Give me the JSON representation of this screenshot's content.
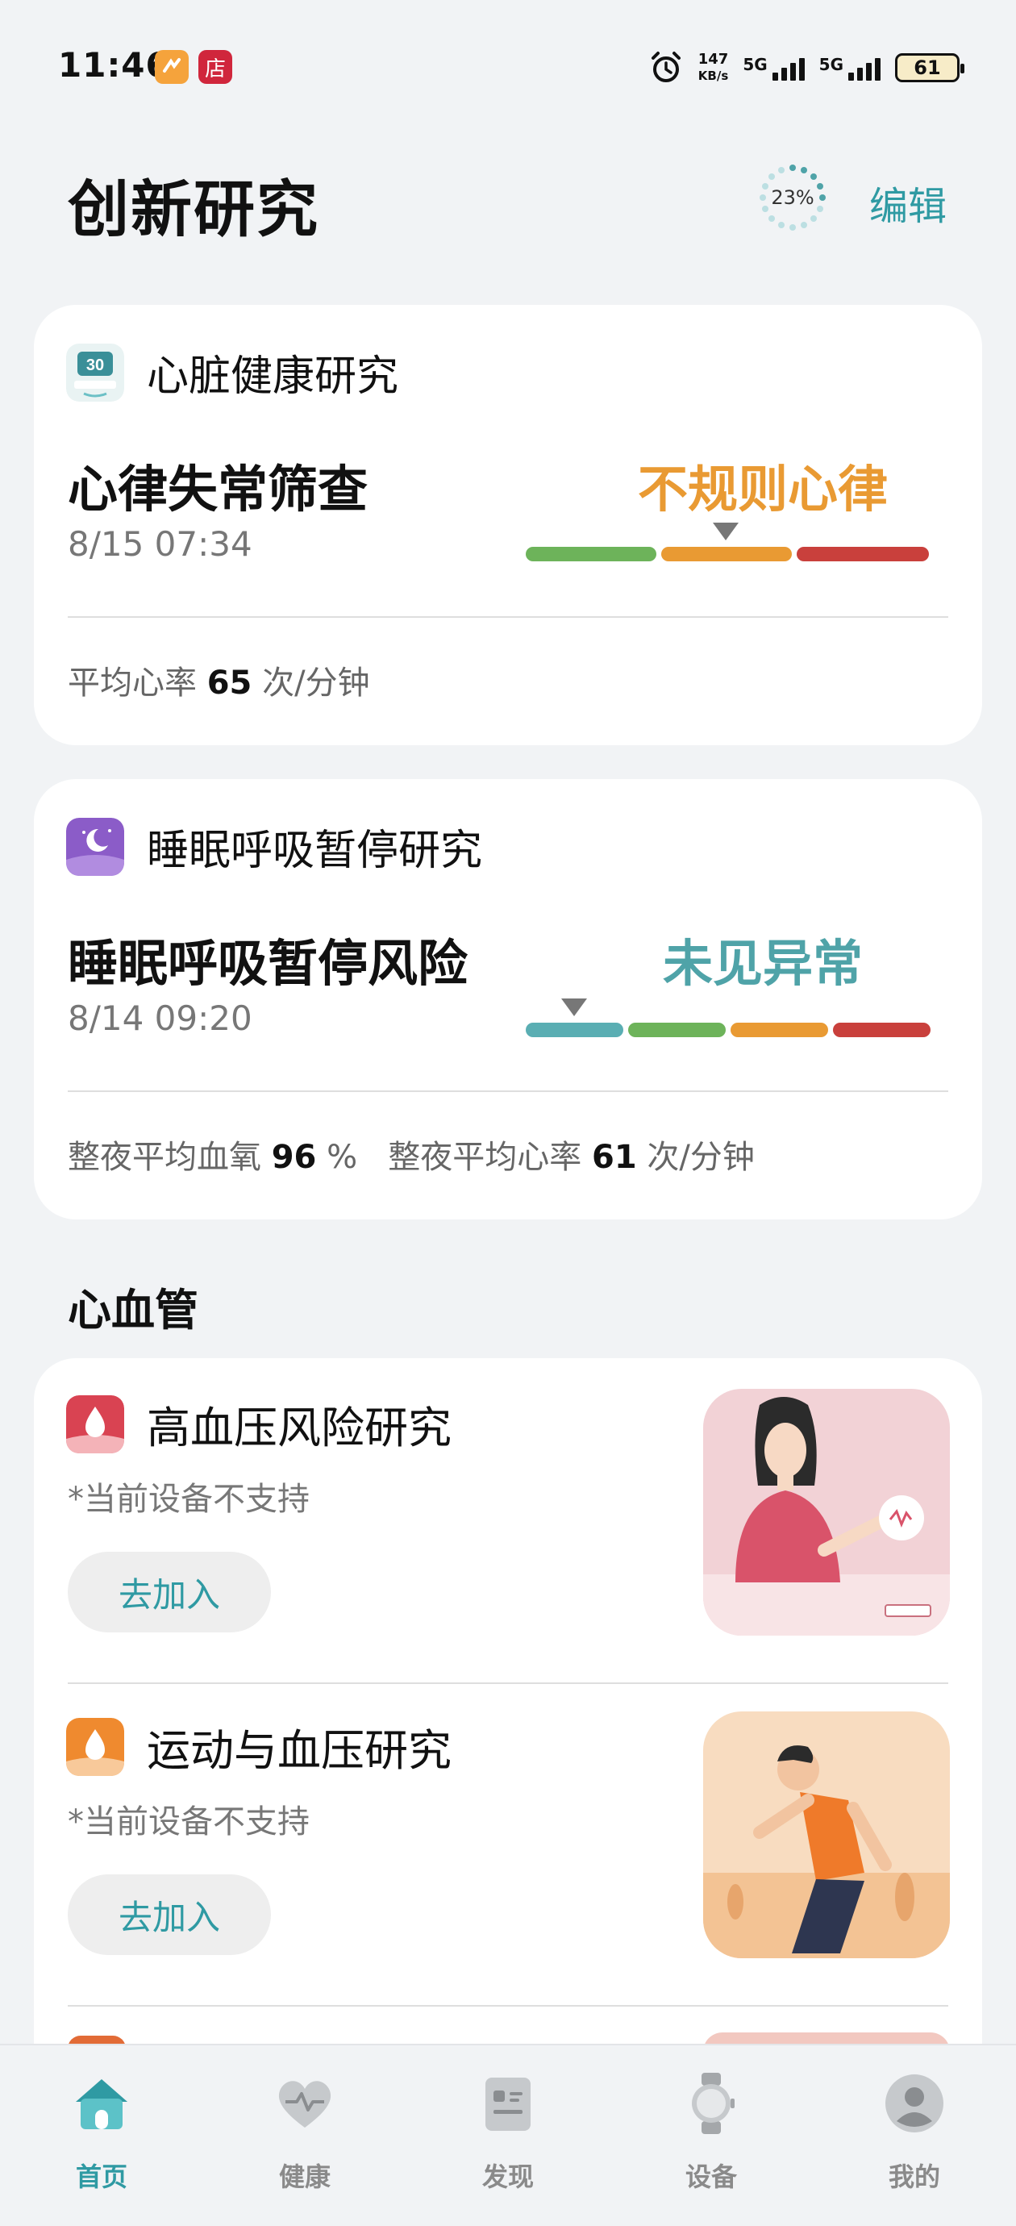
{
  "status_bar": {
    "time": "11:46",
    "app_icon_2": "店",
    "net_speed_value": "147",
    "net_speed_unit": "KB/s",
    "sim1_label": "5G",
    "sim2_label": "5G",
    "battery": "61"
  },
  "header": {
    "title": "创新研究",
    "progress": "23%",
    "edit_label": "编辑"
  },
  "heart_study": {
    "name": "心脏健康研究",
    "metric": "心律失常筛查",
    "date": "8/15 07:34",
    "result": "不规则心律",
    "result_color": "#e99a33",
    "footer_label": "平均心率",
    "footer_value": "65",
    "footer_unit": "次/分钟"
  },
  "sleep_study": {
    "name": "睡眠呼吸暂停研究",
    "metric": "睡眠呼吸暂停风险",
    "date": "8/14 09:20",
    "result": "未见异常",
    "result_color": "#4fa3a8",
    "spo2_label": "整夜平均血氧",
    "spo2_value": "96",
    "spo2_unit": "%",
    "hr_label": "整夜平均心率",
    "hr_value": "61",
    "hr_unit": "次/分钟"
  },
  "cardio_section": {
    "title": "心血管",
    "items": [
      {
        "name": "高血压风险研究",
        "note": "*当前设备不支持",
        "button": "去加入"
      },
      {
        "name": "运动与血压研究",
        "note": "*当前设备不支持",
        "button": "去加入"
      }
    ]
  },
  "bottom_nav": {
    "items": [
      {
        "label": "首页",
        "icon": "home-icon",
        "active": true
      },
      {
        "label": "健康",
        "icon": "heart-icon",
        "active": false
      },
      {
        "label": "发现",
        "icon": "discover-icon",
        "active": false
      },
      {
        "label": "设备",
        "icon": "watch-icon",
        "active": false
      },
      {
        "label": "我的",
        "icon": "profile-icon",
        "active": false
      }
    ]
  },
  "colors": {
    "accent": "#2f9aa3",
    "scale_green": "#6db35a",
    "scale_orange": "#e99a33",
    "scale_red": "#c9403c",
    "scale_teal": "#5aaeb3"
  }
}
